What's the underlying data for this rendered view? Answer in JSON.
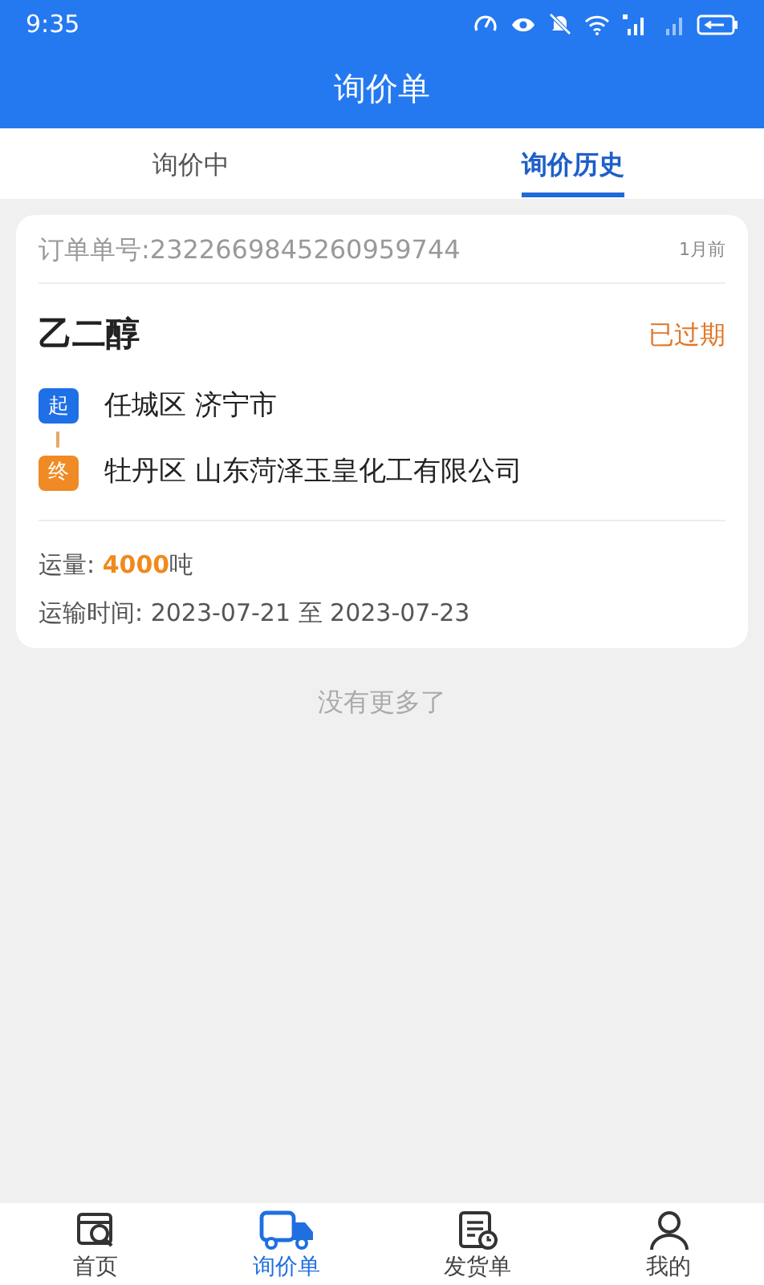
{
  "status_bar": {
    "time": "9:35"
  },
  "title": "询价单",
  "tabs": [
    {
      "label": "询价中",
      "selected": false
    },
    {
      "label": "询价历史",
      "selected": true
    }
  ],
  "orders": [
    {
      "order_no": "订单单号:2322669845260959744",
      "age": "1月前",
      "product": "乙二醇",
      "status": "已过期",
      "origin_badge": "起",
      "origin": "任城区 济宁市",
      "dest_badge": "终",
      "destination": "牡丹区 山东菏泽玉皇化工有限公司",
      "amount": "运量: **4000**吨",
      "time": "运输时间: 2023-07-21 至 2023-07-23"
    }
  ],
  "end_note": "没有更多了",
  "nav": [
    {
      "label": "首页",
      "selected": false
    },
    {
      "label": "询价单",
      "selected": true
    },
    {
      "label": "发货单",
      "selected": false
    },
    {
      "label": "我的",
      "selected": false
    }
  ]
}
